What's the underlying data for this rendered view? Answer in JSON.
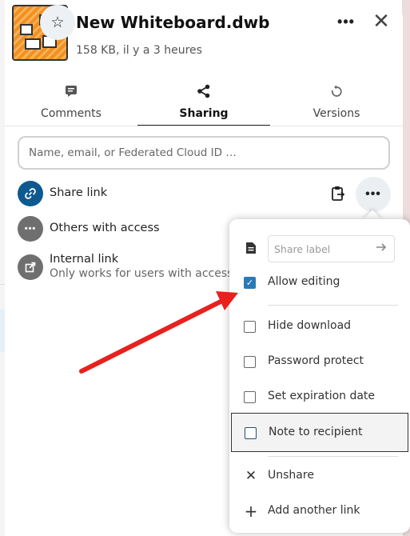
{
  "header": {
    "file_name": "New Whiteboard.dwb",
    "file_meta": "158 KB, il y a 3 heures"
  },
  "tabs": [
    {
      "label": "Comments",
      "icon": "comment-icon"
    },
    {
      "label": "Sharing",
      "icon": "share-icon",
      "active": true
    },
    {
      "label": "Versions",
      "icon": "history-icon"
    }
  ],
  "search": {
    "placeholder": "Name, email, or Federated Cloud ID …"
  },
  "share_rows": {
    "share_link": "Share link",
    "others": "Others with access",
    "internal_link": "Internal link",
    "internal_sub": "Only works for users with access t"
  },
  "dropdown": {
    "label_placeholder": "Share label",
    "allow_editing": "Allow editing",
    "allow_editing_checked": true,
    "hide_download": "Hide download",
    "password_protect": "Password protect",
    "set_expiration": "Set expiration date",
    "note_to_recipient": "Note to recipient",
    "unshare": "Unshare",
    "add_another": "Add another link"
  },
  "colors": {
    "accent": "#2a7ab5",
    "share_link_icon": "#0e5a90",
    "neutral_icon": "#6f6f6f",
    "annotation_arrow": "#e8211e"
  }
}
